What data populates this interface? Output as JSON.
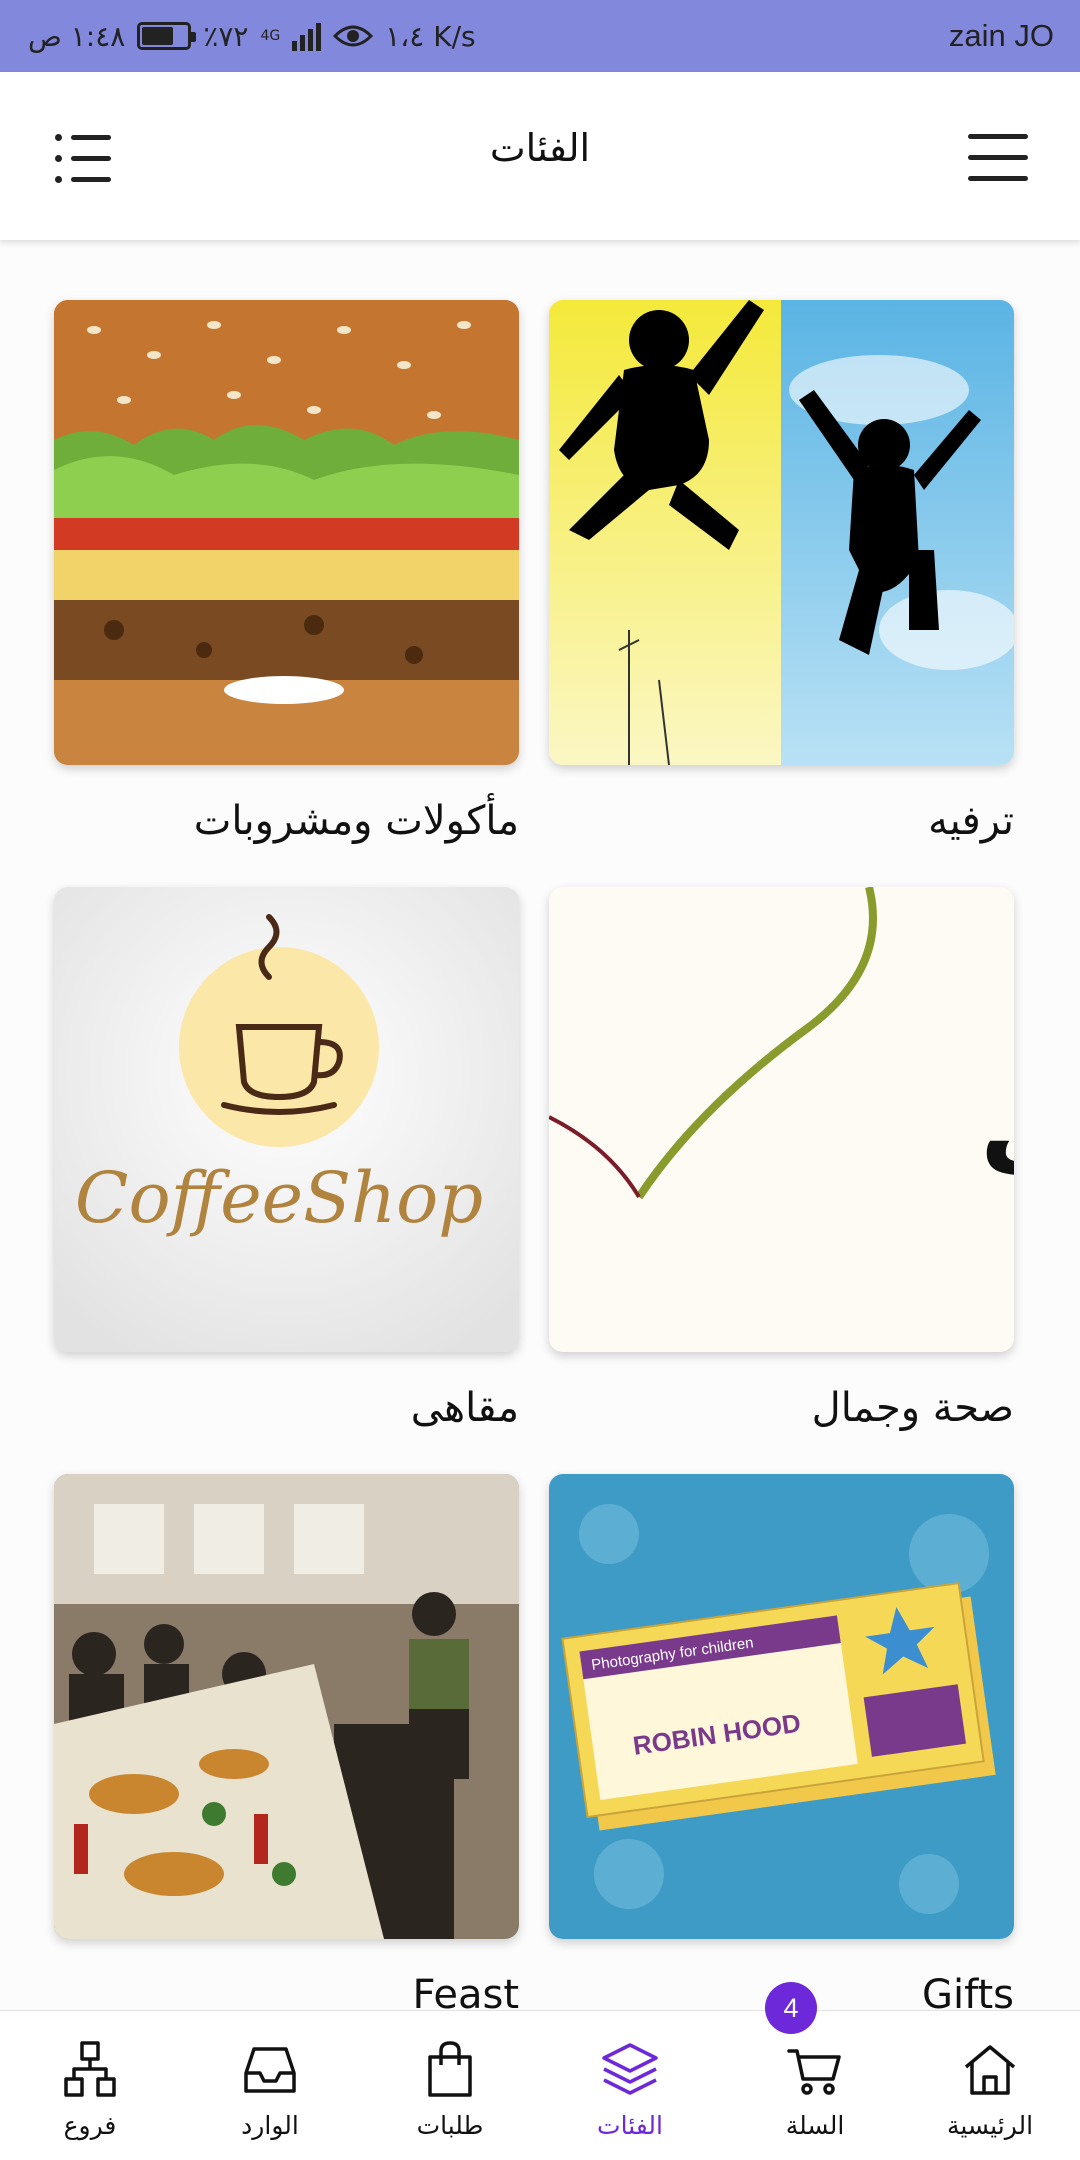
{
  "status_bar": {
    "carrier": "zain JO",
    "speed": "١،٤ K/s",
    "network": "4G",
    "battery": "٪٧٢",
    "battery_level": 0.72,
    "time": "١:٤٨ ص"
  },
  "header": {
    "title": "الفئات",
    "menu_icon": "hamburger-menu-icon",
    "list_icon": "list-view-icon"
  },
  "categories": [
    {
      "label": "ترفيه",
      "image": "jumping-silhouettes"
    },
    {
      "label": "مأكولات ومشروبات",
      "image": "burger"
    },
    {
      "label": "صحة وجمال",
      "image_text": "صحّة وجمال"
    },
    {
      "label": "مقاهى",
      "image_text": "CoffeeShop"
    },
    {
      "label": "Gifts",
      "image": "gift-voucher",
      "voucher_title": "Photography for children",
      "voucher_text": "ROBIN HOOD"
    },
    {
      "label": "Feast",
      "image": "restaurant-dining"
    }
  ],
  "bottom_nav": {
    "items": [
      {
        "label": "الرئيسية",
        "icon": "home-icon"
      },
      {
        "label": "السلة",
        "icon": "cart-icon"
      },
      {
        "label": "الفئات",
        "icon": "layers-icon",
        "active": true
      },
      {
        "label": "طلبات",
        "icon": "shopping-bag-icon"
      },
      {
        "label": "الوارد",
        "icon": "inbox-icon"
      },
      {
        "label": "فروع",
        "icon": "branches-icon"
      }
    ],
    "cart_count": "4",
    "active_color": "#6d28d9"
  }
}
